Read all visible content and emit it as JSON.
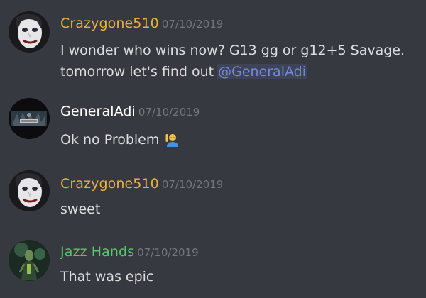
{
  "colors": {
    "background": "#36393f",
    "crazygone": "#e8b13f",
    "generaladi": "#ffffff",
    "jazzhands": "#57c96a",
    "mention": "#7289da",
    "timestamp": "#72767d",
    "text": "#dcddde"
  },
  "messages": [
    {
      "username": "Crazygone510",
      "timestamp": "07/10/2019",
      "line1": "I wonder who wins now? G13 gg or g12+5 Savage.",
      "line2_prefix": "tomorrow let's find out",
      "mention": "@GeneralAdi",
      "avatar_icon": "joker-avatar-icon"
    },
    {
      "username": "GeneralAdi",
      "timestamp": "07/10/2019",
      "text": "Ok no Problem",
      "emoji_icon": "person-raising-hand-icon",
      "avatar_icon": "army-logo-avatar-icon"
    },
    {
      "username": "Crazygone510",
      "timestamp": "07/10/2019",
      "text": "sweet",
      "avatar_icon": "joker-avatar-icon"
    },
    {
      "username": "Jazz Hands",
      "timestamp": "07/10/2019",
      "text": "That was epic",
      "avatar_icon": "green-figure-avatar-icon"
    }
  ]
}
